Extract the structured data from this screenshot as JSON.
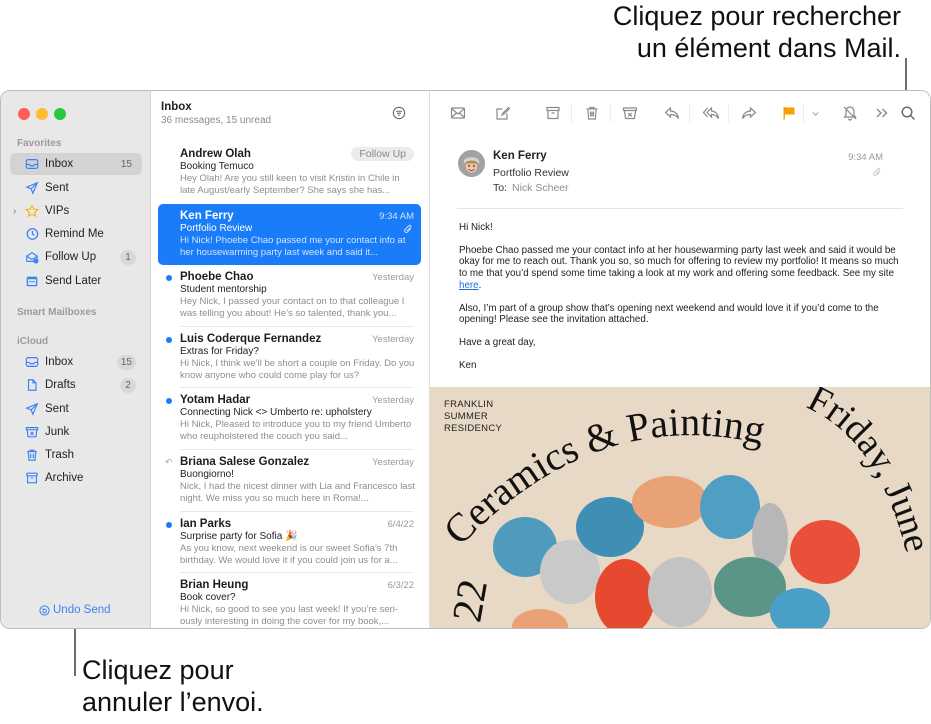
{
  "callouts": {
    "search": [
      "Cliquez pour rechercher",
      "un élément dans Mail."
    ],
    "undo": [
      "Cliquez pour",
      "annuler l’envoi."
    ]
  },
  "colors": {
    "accent": "#1a7cf8",
    "sidebar_icon": "#3a82f7",
    "flag": "#f5a000",
    "traffic_close": "#ff5f57",
    "traffic_minimize": "#febc2e",
    "traffic_zoom": "#28c840"
  },
  "sidebar": {
    "favorites_label": "Favorites",
    "favorites": [
      {
        "label": "Inbox",
        "icon": "inbox-icon",
        "badge": "15",
        "active": true
      },
      {
        "label": "Sent",
        "icon": "paperplane-icon",
        "badge": ""
      },
      {
        "label": "VIPs",
        "icon": "star-icon",
        "badge": "",
        "expandable": true
      },
      {
        "label": "Remind Me",
        "icon": "clock-icon",
        "badge": ""
      },
      {
        "label": "Follow Up",
        "icon": "follow-up-icon",
        "badge": "1"
      },
      {
        "label": "Send Later",
        "icon": "calendar-icon",
        "badge": ""
      }
    ],
    "smart_mailboxes_label": "Smart Mailboxes",
    "icloud_label": "iCloud",
    "icloud": [
      {
        "label": "Inbox",
        "icon": "inbox-icon",
        "badge": "15"
      },
      {
        "label": "Drafts",
        "icon": "document-icon",
        "badge": "2"
      },
      {
        "label": "Sent",
        "icon": "paperplane-icon",
        "badge": ""
      },
      {
        "label": "Junk",
        "icon": "junk-icon",
        "badge": ""
      },
      {
        "label": "Trash",
        "icon": "trash-icon",
        "badge": ""
      },
      {
        "label": "Archive",
        "icon": "archive-icon",
        "badge": ""
      }
    ],
    "undo_send": "Undo Send"
  },
  "list": {
    "title": "Inbox",
    "subtitle": "36 messages, 15 unread",
    "messages": [
      {
        "sender": "Andrew Olah",
        "date": "",
        "tag": "Follow Up",
        "subject": "Booking Temuco",
        "preview": "Hey Olah! Are you still keen to visit Kristin in Chile in late August/early September? She says she has...",
        "unread": false,
        "replied": false,
        "selected": false,
        "attachment": false
      },
      {
        "sender": "Ken Ferry",
        "date": "9:34 AM",
        "tag": "",
        "subject": "Portfolio Review",
        "preview": "Hi Nick! Phoebe Chao passed me your contact info at her housewarming party last week and said it...",
        "unread": false,
        "replied": false,
        "selected": true,
        "attachment": true
      },
      {
        "sender": "Phoebe Chao",
        "date": "Yesterday",
        "tag": "",
        "subject": "Student mentorship",
        "preview": "Hey Nick, I passed your contact on to that colleague I was telling you about! He’s so talented, thank you...",
        "unread": true,
        "replied": false,
        "selected": false,
        "attachment": false
      },
      {
        "sender": "Luis Coderque Fernandez",
        "date": "Yesterday",
        "tag": "",
        "subject": "Extras for Friday?",
        "preview": "Hi Nick, I think we’ll be short a couple on Friday. Do you know anyone who could come play for us?",
        "unread": true,
        "replied": false,
        "selected": false,
        "attachment": false
      },
      {
        "sender": "Yotam Hadar",
        "date": "Yesterday",
        "tag": "",
        "subject": "Connecting Nick <> Umberto re: upholstery",
        "preview": "Hi Nick, Pleased to introduce you to my friend Umberto who reupholstered the couch you said...",
        "unread": true,
        "replied": false,
        "selected": false,
        "attachment": false
      },
      {
        "sender": "Briana Salese Gonzalez",
        "date": "Yesterday",
        "tag": "",
        "subject": "Buongiorno!",
        "preview": "Nick, I had the nicest dinner with Lia and Francesco last night. We miss you so much here in Roma!...",
        "unread": false,
        "replied": true,
        "selected": false,
        "attachment": false
      },
      {
        "sender": "Ian Parks",
        "date": "6/4/22",
        "tag": "",
        "subject": "Surprise party for Sofia 🎉",
        "preview": "As you know, next weekend is our sweet Sofia’s 7th birthday. We would love it if you could join us for a...",
        "unread": true,
        "replied": false,
        "selected": false,
        "attachment": false
      },
      {
        "sender": "Brian Heung",
        "date": "6/3/22",
        "tag": "",
        "subject": "Book cover?",
        "preview": "Hi Nick, so good to see you last week! If you’re seri-ously interesting in doing the cover for my book,...",
        "unread": false,
        "replied": false,
        "selected": false,
        "attachment": false
      }
    ]
  },
  "toolbar": {
    "buttons": [
      "get-mail",
      "compose",
      "archive",
      "delete",
      "junk",
      "reply",
      "reply-all",
      "forward",
      "flag",
      "flag-menu",
      "mute",
      "more",
      "search"
    ]
  },
  "message": {
    "from": "Ken Ferry",
    "subject": "Portfolio Review",
    "to_label": "To:",
    "to": "Nick Scheer",
    "time": "9:34 AM",
    "greeting": "Hi Nick!",
    "para1": "Phoebe Chao passed me your contact info at her housewarming party last week and said it would be okay for me to reach out. Thank you so, so much for offering to review my portfolio! It means so much to me that you’d spend some time taking a look at my work and offering some feedback. See my site ",
    "link": "here",
    "para1_end": ".",
    "para2": "Also, I’m part of a group show that’s opening next weekend and would love it if you’d come to the opening! Please see the invitation attached.",
    "closing": "Have a great day,",
    "signature": "Ken"
  },
  "poster": {
    "org": [
      "FRANKLIN",
      "SUMMER",
      "RESIDENCY"
    ],
    "title": "Ceramics & Painting",
    "date_text": "Friday, June",
    "year_fragment": "22"
  }
}
